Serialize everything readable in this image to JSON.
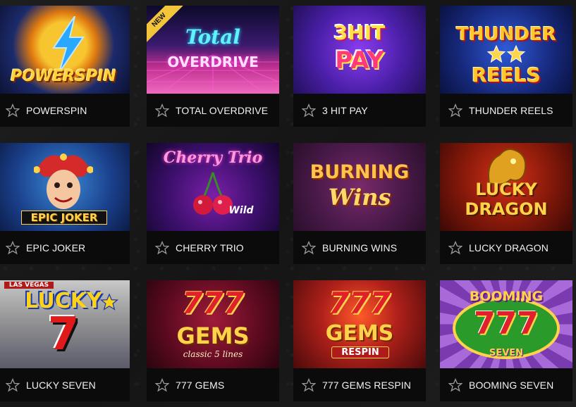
{
  "games": [
    {
      "name": "POWERSPIN",
      "logo": "POWERSPIN",
      "logo2": "",
      "badge": ""
    },
    {
      "name": "TOTAL OVERDRIVE",
      "logo": "Total",
      "logo2": "OVERDRIVE",
      "badge": "NEW"
    },
    {
      "name": "3 HIT PAY",
      "logo": "3HIT",
      "logo2": "PAY",
      "badge": ""
    },
    {
      "name": "THUNDER REELS",
      "logo": "THUNDER",
      "logo2": "REELS",
      "badge": ""
    },
    {
      "name": "EPIC JOKER",
      "logo": "EPIC JOKER",
      "logo2": "",
      "badge": ""
    },
    {
      "name": "CHERRY TRIO",
      "logo": "Cherry Trio",
      "logo2": "Wild",
      "badge": ""
    },
    {
      "name": "BURNING WINS",
      "logo": "BURNING",
      "logo2": "Wins",
      "badge": ""
    },
    {
      "name": "LUCKY DRAGON",
      "logo": "LUCKY",
      "logo2": "DRAGON",
      "badge": ""
    },
    {
      "name": "LUCKY SEVEN",
      "logo": "LUCKY",
      "logo2": "7",
      "sub": "LAS VEGAS",
      "badge": ""
    },
    {
      "name": "777 GEMS",
      "logo": "777",
      "logo2": "GEMS",
      "sub": "classic 5 lines",
      "badge": ""
    },
    {
      "name": "777 GEMS RESPIN",
      "logo": "777",
      "logo2": "GEMS",
      "sub": "RESPIN",
      "badge": ""
    },
    {
      "name": "BOOMING SEVEN",
      "logo": "BOOMING",
      "logo2": "777",
      "sub": "SEVEN",
      "badge": ""
    }
  ],
  "icons": {
    "favorite": "star-outline-icon"
  },
  "colors": {
    "label_text": "#f2f2f2",
    "bar": "#0b0b0b",
    "badge": "#f3c53a"
  }
}
